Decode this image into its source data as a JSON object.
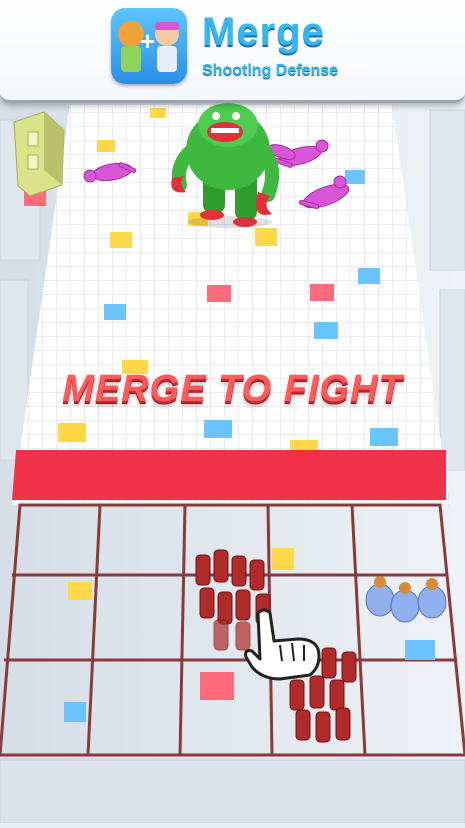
{
  "banner": {
    "title": "Merge",
    "subtitle": "Shooting Defense",
    "icon_plus": "+"
  },
  "headline": "MERGE TO FIGHT",
  "icons": {
    "app": "app-icon",
    "hand": "pointing-hand-icon",
    "boss": "green-crab-monster",
    "tower": "watchtower"
  },
  "colors": {
    "accent": "#35b6ef",
    "headline": "#ff5a5a",
    "defense_line": "#f0314a",
    "grid_line": "#8a3a3a",
    "boss": "#3fb83f",
    "enemy": "#d855d8",
    "red_soldier": "#b02a2a",
    "blue_soldier": "#8fb0ec"
  },
  "merge_grid": {
    "rows": 3,
    "cols": 5,
    "units": [
      {
        "row": 1,
        "col": 2,
        "type": "red-soldier-squad"
      },
      {
        "row": 1,
        "col": 4,
        "type": "blue-soldier-squad"
      },
      {
        "row": 2,
        "col": 3,
        "type": "red-soldier-squad"
      }
    ]
  },
  "enemies": [
    {
      "type": "green-boss"
    },
    {
      "type": "pink-stickman",
      "state": "fallen"
    },
    {
      "type": "pink-stickman",
      "state": "fallen"
    },
    {
      "type": "pink-stickman",
      "state": "fallen"
    },
    {
      "type": "pink-stickman",
      "state": "fallen"
    }
  ]
}
